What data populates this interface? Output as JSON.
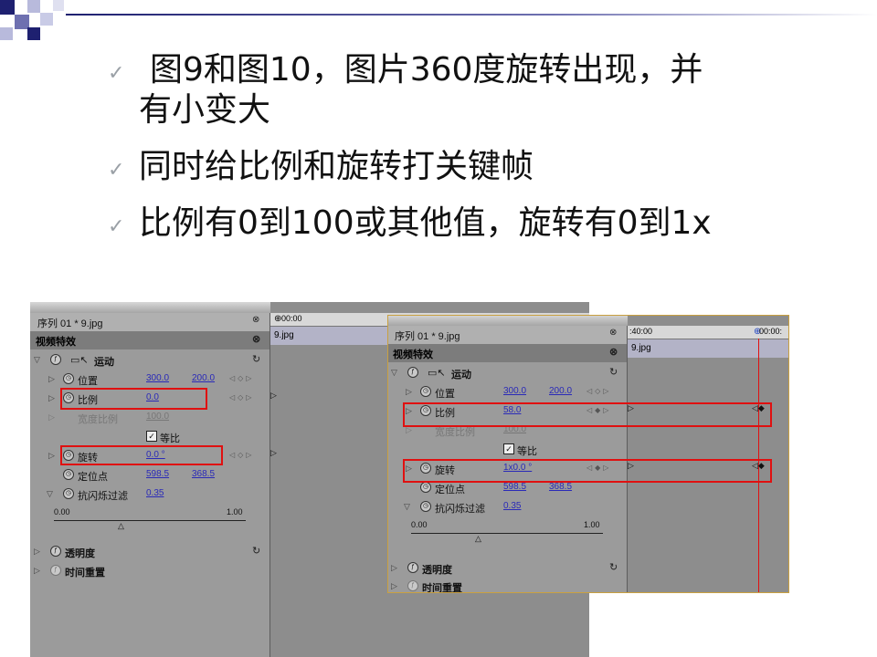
{
  "bullets": [
    {
      "text_line1": "图9和图10，图片360度旋转出现，并",
      "text_line2": "有小变大"
    },
    {
      "text": "同时给比例和旋转打关键帧"
    },
    {
      "text": "比例有0到100或其他值，旋转有0到1x"
    }
  ],
  "panel_left": {
    "sequence": "序列 01 * 9.jpg",
    "section": "视频特效",
    "clip_name": "9.jpg",
    "ruler_label": "00:00",
    "motion": "运动",
    "position_label": "位置",
    "position_x": "300.0",
    "position_y": "200.0",
    "scale_label": "比例",
    "scale_value": "0.0",
    "width_scale_label": "宽度比例",
    "width_scale_value": "100.0",
    "uniform_label": "等比",
    "rotation_label": "旋转",
    "rotation_value": "0.0 °",
    "anchor_label": "定位点",
    "anchor_x": "598.5",
    "anchor_y": "368.5",
    "flicker_label": "抗闪烁过滤",
    "flicker_value": "0.35",
    "slider_min": "0.00",
    "slider_max": "1.00",
    "opacity": "透明度",
    "time_remap": "时间重置"
  },
  "panel_right": {
    "sequence": "序列 01 * 9.jpg",
    "section": "视频特效",
    "clip_name": "9.jpg",
    "ruler_left": ":40:00",
    "ruler_right": "00:00:",
    "motion": "运动",
    "position_label": "位置",
    "position_x": "300.0",
    "position_y": "200.0",
    "scale_label": "比例",
    "scale_value": "58.0",
    "width_scale_label": "宽度比例",
    "width_scale_value": "100.0",
    "uniform_label": "等比",
    "rotation_label": "旋转",
    "rotation_value": "1x0.0 °",
    "anchor_label": "定位点",
    "anchor_x": "598.5",
    "anchor_y": "368.5",
    "flicker_label": "抗闪烁过滤",
    "flicker_value": "0.35",
    "slider_min": "0.00",
    "slider_max": "1.00",
    "opacity": "透明度",
    "time_remap": "时间重置"
  },
  "colors": {
    "highlight": "#e01010",
    "value_link": "#2a2ab8",
    "clip": "#b3b3c7"
  }
}
